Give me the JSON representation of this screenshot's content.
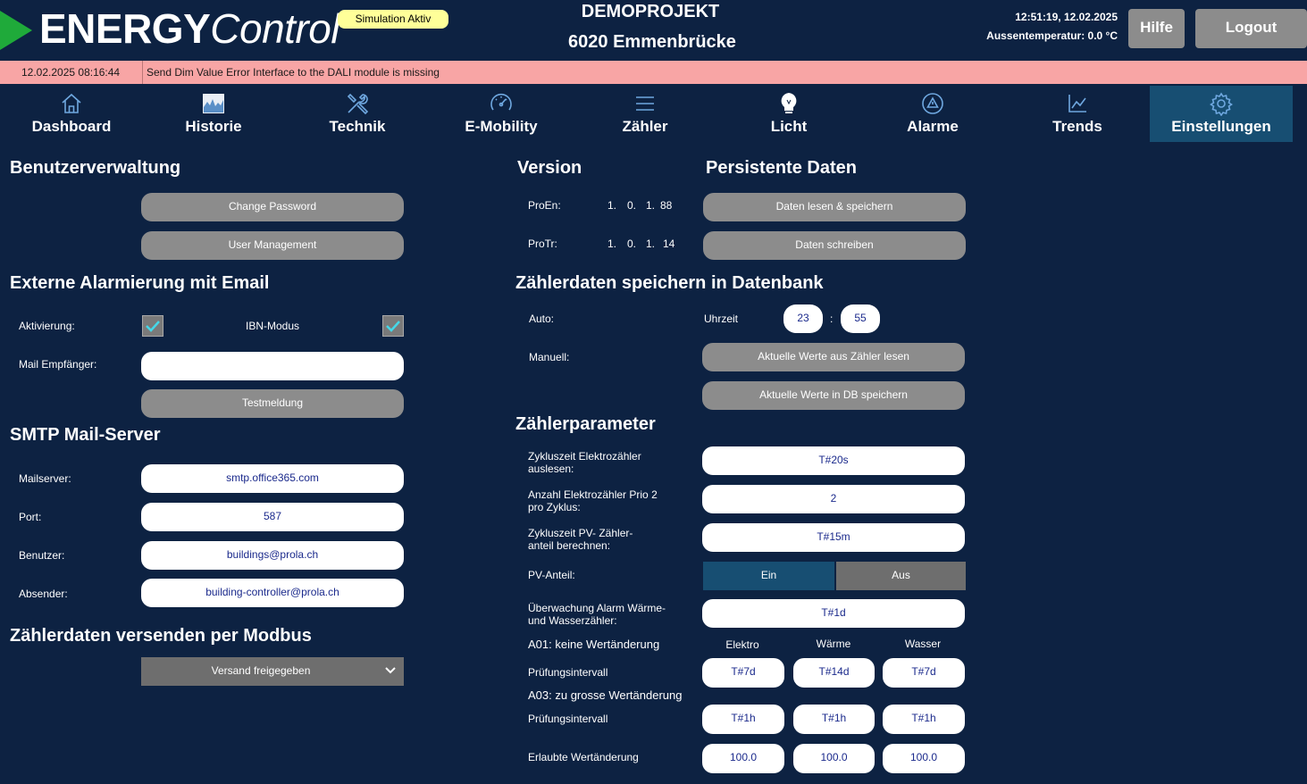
{
  "header": {
    "logo_bold": "ENERGY",
    "logo_italic": "Control",
    "badge": "Simulation Aktiv",
    "project_line1": "DEMOPROJEKT",
    "project_line2": "6020 Emmenbrücke",
    "clock": "12:51:19, 12.02.2025",
    "temperature": "Aussentemperatur: 0.0 °C",
    "help_label": "Hilfe",
    "logout_label": "Logout"
  },
  "alarm": {
    "time": "12.02.2025 08:16:44",
    "message": "Send Dim Value Error  Interface to the DALI module is missing"
  },
  "nav": {
    "items": [
      {
        "label": "Dashboard",
        "icon": "home-icon"
      },
      {
        "label": "Historie",
        "icon": "history-chart-icon"
      },
      {
        "label": "Technik",
        "icon": "tools-icon"
      },
      {
        "label": "E-Mobility",
        "icon": "gauge-icon"
      },
      {
        "label": "Zähler",
        "icon": "menu-lines-icon"
      },
      {
        "label": "Licht",
        "icon": "lightbulb-icon"
      },
      {
        "label": "Alarme",
        "icon": "warning-icon"
      },
      {
        "label": "Trends",
        "icon": "trend-chart-icon"
      },
      {
        "label": "Einstellungen",
        "icon": "gear-icon"
      }
    ],
    "active": "Einstellungen",
    "active_color": "#174e72"
  },
  "users": {
    "title": "Benutzerverwaltung",
    "change_password": "Change Password",
    "user_management": "User Management"
  },
  "email_alarm": {
    "title": "Externe Alarmierung mit Email",
    "activation_label": "Aktivierung:",
    "ibn_label": "IBN-Modus",
    "recipient_label": "Mail Empfänger:",
    "recipient_value": "",
    "test_button": "Testmeldung"
  },
  "smtp": {
    "title": "SMTP Mail-Server",
    "server_label": "Mailserver:",
    "server_value": "smtp.office365.com",
    "port_label": "Port:",
    "port_value": "587",
    "user_label": "Benutzer:",
    "user_value": "buildings@prola.ch",
    "sender_label": "Absender:",
    "sender_value": "building-controller@prola.ch"
  },
  "modbus": {
    "title": "Zählerdaten versenden per Modbus",
    "selected": "Versand freigegeben"
  },
  "version": {
    "title": "Version",
    "proen_label": "ProEn:",
    "proen_parts": [
      "1.",
      "0.",
      "1.",
      "88"
    ],
    "protr_label": "ProTr:",
    "protr_parts": [
      "1.",
      "0.",
      "1.",
      "14"
    ]
  },
  "persistent": {
    "title": "Persistente Daten",
    "read_save": "Daten lesen & speichern",
    "write": "Daten schreiben"
  },
  "db_save": {
    "title": "Zählerdaten speichern in Datenbank",
    "auto_label": "Auto:",
    "time_label": "Uhrzeit",
    "hour": "23",
    "colon": ":",
    "minute": "55",
    "manual_label": "Manuell:",
    "read_current": "Aktuelle Werte aus Zähler lesen",
    "save_db": "Aktuelle Werte in DB speichern"
  },
  "params": {
    "title": "Zählerparameter",
    "cycle_elec_label": "Zykluszeit Elektrozähler auslesen:",
    "cycle_elec_value": "T#20s",
    "count_prio_label": "Anzahl Elektrozähler Prio 2 pro Zyklus:",
    "count_prio_value": "2",
    "cycle_pv_label": "Zykluszeit PV- Zähler-anteil berechnen:",
    "cycle_pv_value": "T#15m",
    "pv_label": "PV-Anteil:",
    "pv_on": "Ein",
    "pv_off": "Aus",
    "monitor_label": "Überwachung Alarm Wärme- und Wasserzähler:",
    "monitor_value": "T#1d",
    "a01_label": "A01: keine Wertänderung",
    "col_elektro": "Elektro",
    "col_waerme": "Wärme",
    "col_wasser": "Wasser",
    "interval1_label": "Prüfungsintervall",
    "interval1_values": [
      "T#7d",
      "T#14d",
      "T#7d"
    ],
    "a03_label": "A03: zu grosse Wertänderung",
    "interval2_label": "Prüfungsintervall",
    "interval2_values": [
      "T#1h",
      "T#1h",
      "T#1h"
    ],
    "allowed_label": "Erlaubte Wertänderung",
    "allowed_values": [
      "100.0",
      "100.0",
      "100.0"
    ]
  }
}
